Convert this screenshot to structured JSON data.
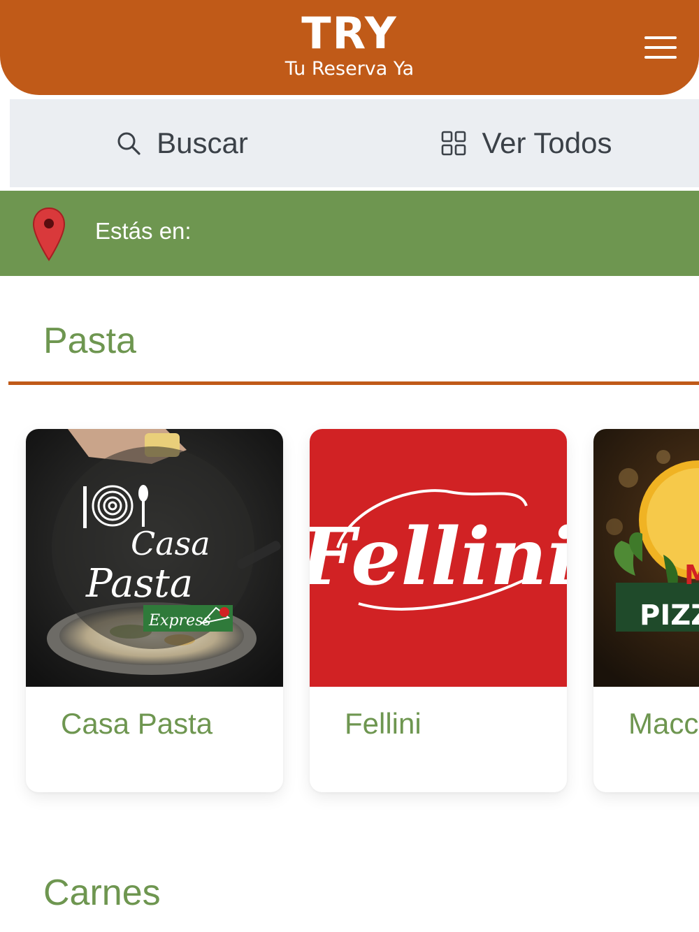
{
  "header": {
    "brand_title": "TRY",
    "brand_subtitle": "Tu Reserva Ya",
    "menu_icon": "hamburger-menu-icon"
  },
  "actions": {
    "search_label": "Buscar",
    "search_icon": "search-icon",
    "view_all_label": "Ver Todos",
    "view_all_icon": "grid-icon"
  },
  "location": {
    "label": "Estás en:",
    "icon": "map-pin-icon"
  },
  "sections": [
    {
      "title": "Pasta",
      "restaurants": [
        {
          "name": "Casa Pasta",
          "logo_text": [
            "Casa",
            "Pasta",
            "Express"
          ]
        },
        {
          "name": "Fellini",
          "logo_text": [
            "Fellini"
          ]
        },
        {
          "name": "Macco Pizza",
          "logo_text": [
            "PIZZA"
          ]
        }
      ]
    },
    {
      "title": "Carnes"
    }
  ],
  "colors": {
    "primary_orange": "#c05a18",
    "primary_green": "#6e9650",
    "action_bar_bg": "#ebeef2",
    "fellini_red": "#d12224",
    "text_dark": "#3b4148"
  }
}
